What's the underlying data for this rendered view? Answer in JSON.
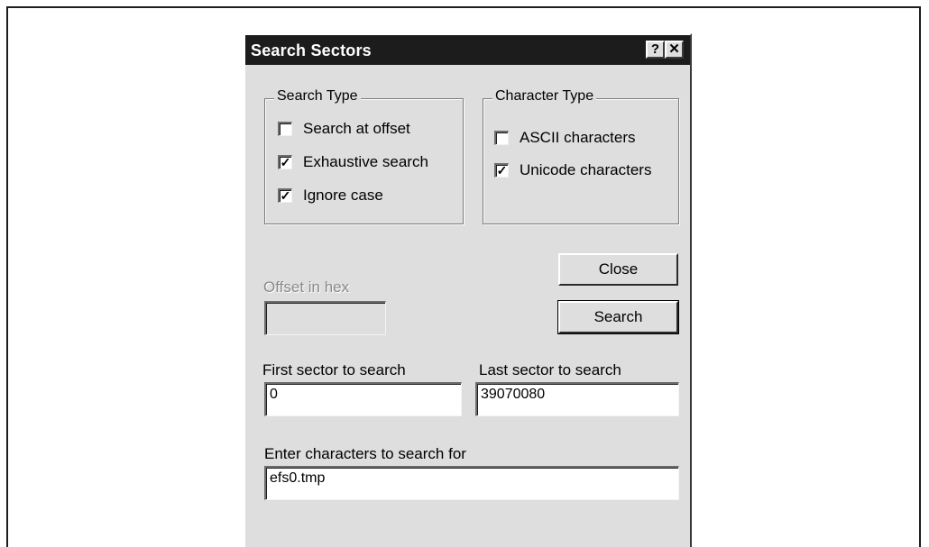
{
  "dialog": {
    "title": "Search Sectors",
    "help_glyph": "?",
    "close_glyph": "✕"
  },
  "search_type": {
    "legend": "Search Type",
    "options": [
      {
        "label": "Search at offset",
        "checked": false
      },
      {
        "label": "Exhaustive search",
        "checked": true
      },
      {
        "label": "Ignore case",
        "checked": true
      }
    ]
  },
  "character_type": {
    "legend": "Character Type",
    "options": [
      {
        "label": "ASCII characters",
        "checked": false
      },
      {
        "label": "Unicode characters",
        "checked": true
      }
    ]
  },
  "offset": {
    "label": "Offset in hex",
    "value": ""
  },
  "buttons": {
    "close_label": "Close",
    "search_label": "Search"
  },
  "first_sector": {
    "label": "First sector to search",
    "value": "0"
  },
  "last_sector": {
    "label": "Last sector to search",
    "value": "39070080"
  },
  "search_chars": {
    "label": "Enter characters to search for",
    "value": "efs0.tmp"
  },
  "check_glyph": "✓",
  "icons": [
    "help-icon",
    "close-icon",
    "checkmark-icon"
  ]
}
